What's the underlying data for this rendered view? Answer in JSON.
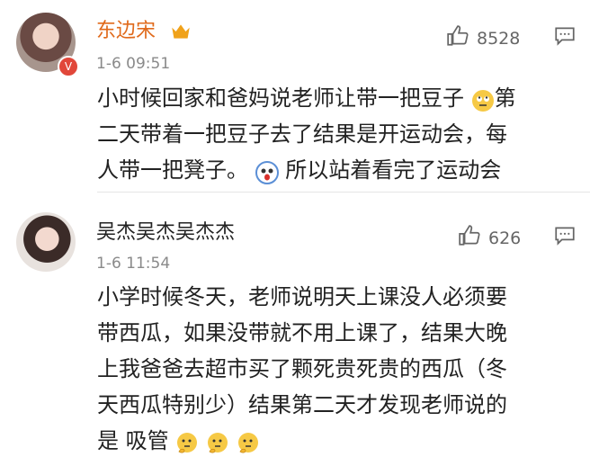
{
  "comments": [
    {
      "author": "东边宋",
      "timestamp": "1-6 09:51",
      "likes": "8528",
      "content_line1": "小时候回家和爸妈说老师让带一把豆子",
      "content_line1b": "第",
      "content_line2": "二天带着一把豆子去了结果是开运动会，每",
      "content_line3a": "人带一把凳子。",
      "content_line3b": "所以站着看完了运动会",
      "badge": "V",
      "crown_icon": "crown-icon",
      "icons": [
        "thumbs-up-icon",
        "comment-icon",
        "rolling-eyes-emoji",
        "shocked-emoji"
      ]
    },
    {
      "author": "吴杰吴杰吴杰杰",
      "timestamp": "1-6 11:54",
      "likes": "626",
      "content_line1": "小学时候冬天，老师说明天上课没人必须要",
      "content_line2": "带西瓜，如果没带就不用上课了，结果大晚",
      "content_line3": "上我爸爸去超市买了颗死贵死贵的西瓜（冬",
      "content_line4": "天西瓜特别少）结果第二天才发现老师说的",
      "content_line5": "是  吸管",
      "icons": [
        "thumbs-up-icon",
        "comment-icon",
        "thinking-emoji",
        "thinking-emoji",
        "thinking-emoji"
      ]
    }
  ],
  "colors": {
    "author_highlight": "#e06a1b",
    "text": "#222222",
    "meta": "#8a8a8a"
  }
}
